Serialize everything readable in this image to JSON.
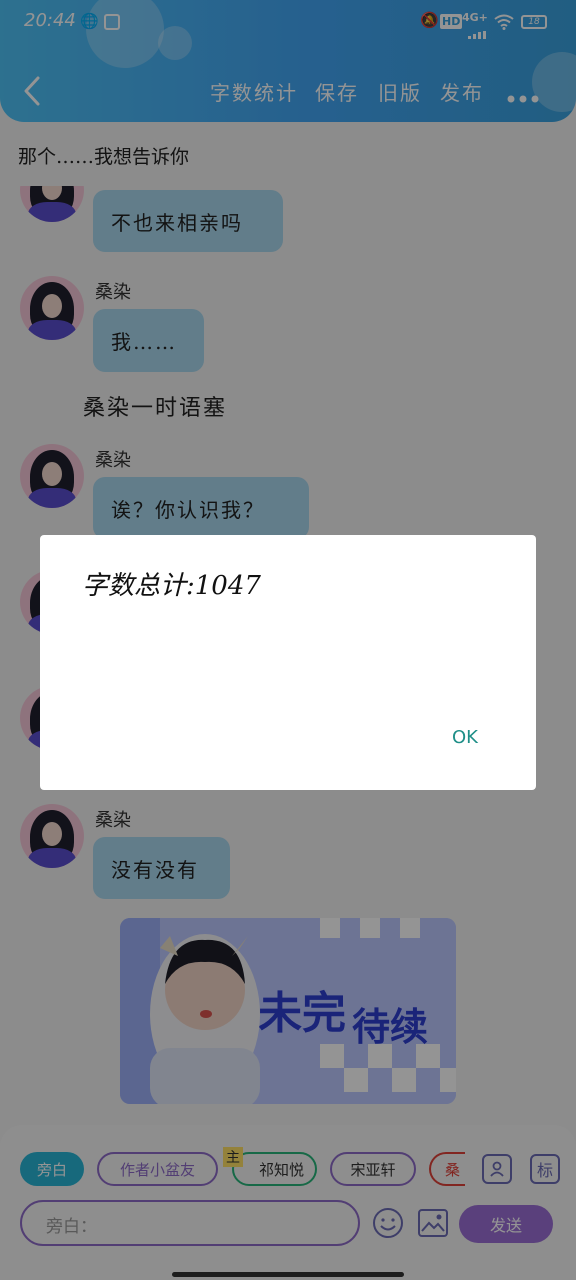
{
  "status_bar": {
    "time": "20:44",
    "hd": "HD",
    "network": "4G+",
    "battery": "18"
  },
  "header": {
    "back_icon": "chevron-left-icon",
    "actions": [
      "字数统计",
      "保存",
      "旧版",
      "发布"
    ],
    "more_icon": "more-dots-icon"
  },
  "chat": {
    "top_narration": "那个……我想告诉你",
    "messages": [
      {
        "text": "不也来相亲吗"
      },
      {
        "name": "桑染",
        "text": "我……"
      },
      {
        "narration": "桑染一时语塞"
      },
      {
        "name": "桑染",
        "text": "诶？你认识我？"
      },
      {
        "name": "桑染",
        "text": "没有没有"
      }
    ]
  },
  "dialog": {
    "message": "字数总计:1047",
    "ok": "OK"
  },
  "input_panel": {
    "chips": [
      "旁白",
      "作者小盆友",
      "祁知悦",
      "宋亚轩",
      "桑"
    ],
    "badge": "主",
    "side_icons": [
      "person-card-icon",
      "tag-icon"
    ],
    "side_label": "标",
    "input_placeholder": "旁白：",
    "emoji_icon": "smile-icon",
    "image_icon": "image-icon",
    "send_label": "发送"
  },
  "colors": {
    "header": "#42a5f5",
    "bubble": "#a9d8ee",
    "chip_active": "#29b6d6",
    "chip_border": "#8e6bc9",
    "send": "#9c6fd6",
    "ok_text": "#1f8f88"
  }
}
